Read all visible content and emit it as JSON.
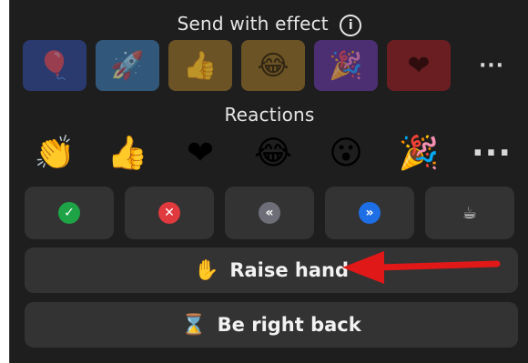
{
  "send_effect": {
    "title": "Send with effect",
    "info_icon": "info-icon",
    "effects": [
      {
        "name": "balloon-effect",
        "glyph": "🎈",
        "bg": "#2b3a6e"
      },
      {
        "name": "rocket-effect",
        "glyph": "🚀",
        "bg": "#31587a"
      },
      {
        "name": "thumbs-up-effect",
        "glyph": "👍",
        "bg": "#6b5326"
      },
      {
        "name": "tears-of-joy-effect",
        "glyph": "😂",
        "bg": "#6b5326"
      },
      {
        "name": "party-popper-effect",
        "glyph": "🎉",
        "bg": "#4b2f72"
      },
      {
        "name": "heart-effect",
        "glyph": "❤",
        "bg": "#6a1e22"
      }
    ],
    "more_label": "···"
  },
  "reactions": {
    "title": "Reactions",
    "items": [
      {
        "name": "clapping-hands-icon",
        "glyph": "👏"
      },
      {
        "name": "thumbs-up-icon",
        "glyph": "👍"
      },
      {
        "name": "heart-icon",
        "glyph": "❤"
      },
      {
        "name": "tears-of-joy-icon",
        "glyph": "😂"
      },
      {
        "name": "surprised-face-icon",
        "glyph": "😮"
      },
      {
        "name": "party-popper-icon",
        "glyph": "🎉"
      }
    ],
    "more_label": "···"
  },
  "status_buttons": [
    {
      "name": "yes-button",
      "icon": "checkmark-icon",
      "symbol": "✓",
      "color": "#1ea446"
    },
    {
      "name": "no-button",
      "icon": "x-icon",
      "symbol": "✕",
      "color": "#e0393e"
    },
    {
      "name": "go-slower-button",
      "icon": "rewind-icon",
      "symbol": "«",
      "color": "#6e6e78"
    },
    {
      "name": "go-faster-button",
      "icon": "fast-forward-icon",
      "symbol": "»",
      "color": "#1e6ee6"
    },
    {
      "name": "coffee-break-button",
      "icon": "coffee-cup-icon",
      "symbol": "☕",
      "color": "#333333"
    }
  ],
  "raise_hand": {
    "label": "Raise hand",
    "icon": "raised-hand-icon",
    "glyph": "✋"
  },
  "be_right_back": {
    "label": "Be right back",
    "icon": "hourglass-icon",
    "glyph": "⌛"
  },
  "annotation_arrow_color": "#e01818"
}
